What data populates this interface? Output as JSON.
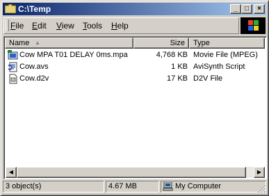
{
  "window": {
    "title": "C:\\Temp",
    "icon": "folder-icon"
  },
  "title_buttons": {
    "minimize": "_",
    "maximize": "□",
    "close": "×"
  },
  "menu": [
    {
      "label": "File",
      "hotkey": "F",
      "rest": "ile"
    },
    {
      "label": "Edit",
      "hotkey": "E",
      "rest": "dit"
    },
    {
      "label": "View",
      "hotkey": "V",
      "rest": "iew"
    },
    {
      "label": "Tools",
      "hotkey": "T",
      "rest": "ools"
    },
    {
      "label": "Help",
      "hotkey": "H",
      "rest": "elp"
    }
  ],
  "columns": {
    "name": "Name",
    "size": "Size",
    "type": "Type"
  },
  "files": [
    {
      "name": "Cow MPA T01 DELAY 0ms.mpa",
      "size": "4,768 KB",
      "type": "Movie File (MPEG)",
      "icon": "movie-file-icon"
    },
    {
      "name": "Cow.avs",
      "size": "1 KB",
      "type": "AviSynth Script",
      "icon": "script-file-icon"
    },
    {
      "name": "Cow.d2v",
      "size": "17 KB",
      "type": "D2V File",
      "icon": "generic-file-icon"
    }
  ],
  "status": {
    "objects": "3 object(s)",
    "size": "4.67 MB",
    "location": "My Computer"
  },
  "colors": {
    "title_start": "#0a246a",
    "title_end": "#a6caf0",
    "face": "#d4d0c8"
  }
}
